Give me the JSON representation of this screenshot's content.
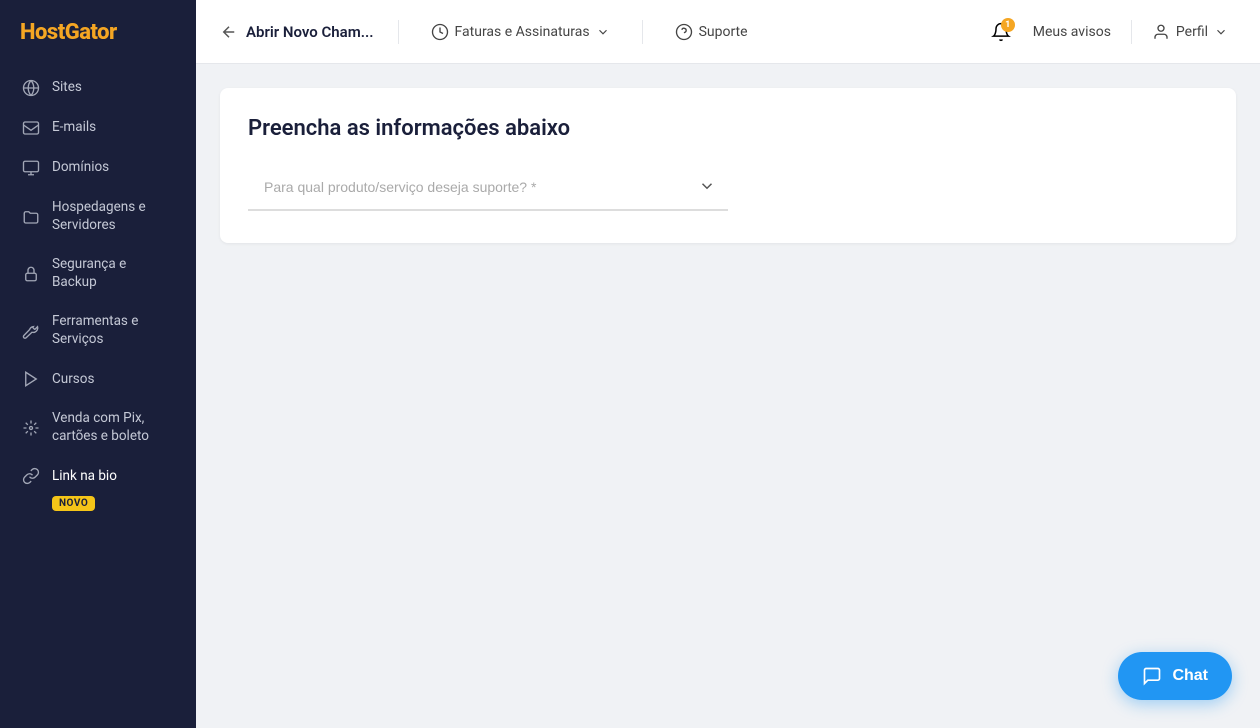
{
  "brand": {
    "name": "HostGator"
  },
  "sidebar": {
    "items": [
      {
        "id": "sites",
        "label": "Sites",
        "icon": "globe"
      },
      {
        "id": "emails",
        "label": "E-mails",
        "icon": "email"
      },
      {
        "id": "domains",
        "label": "Domínios",
        "icon": "domain"
      },
      {
        "id": "hosting",
        "label": "Hospedagens e Servidores",
        "icon": "folder"
      },
      {
        "id": "security",
        "label": "Segurança e Backup",
        "icon": "lock"
      },
      {
        "id": "tools",
        "label": "Ferramentas e Serviços",
        "icon": "tools"
      },
      {
        "id": "courses",
        "label": "Cursos",
        "icon": "courses"
      },
      {
        "id": "pix",
        "label": "Venda com Pix, cartões e boleto",
        "icon": "pix"
      },
      {
        "id": "linkbio",
        "label": "Link na bio",
        "icon": "link",
        "badge": "NOVO"
      }
    ]
  },
  "header": {
    "back_label": "Abrir Novo Cham...",
    "billing_label": "Faturas e Assinaturas",
    "support_label": "Suporte",
    "notifications_label": "Meus avisos",
    "notification_count": "1",
    "profile_label": "Perfil"
  },
  "main": {
    "card_title": "Preencha as informações abaixo",
    "select_placeholder": "Para qual produto/serviço deseja suporte? *"
  },
  "chat": {
    "label": "Chat"
  }
}
